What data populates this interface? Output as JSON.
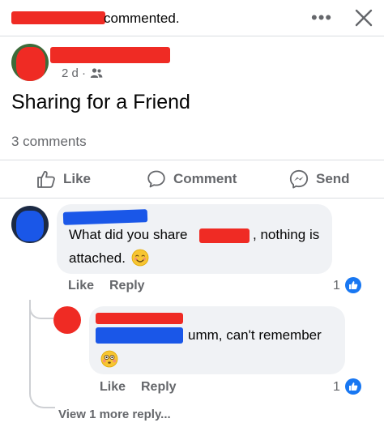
{
  "notification": {
    "suffix": "commented."
  },
  "header": {
    "more_icon": "ellipsis-icon",
    "close_icon": "close-icon"
  },
  "post": {
    "age": "2 d ·",
    "audience_icon": "friends-icon",
    "text": "Sharing for a Friend",
    "comment_count": "3 comments"
  },
  "actions": {
    "like": "Like",
    "comment": "Comment",
    "send": "Send"
  },
  "comment1": {
    "text_part1": "What did you share",
    "text_part2": ", nothing is",
    "text_line2": "attached.",
    "emoji": "smiling-face-icon",
    "like": "Like",
    "reply": "Reply",
    "reaction_count": "1"
  },
  "reply1": {
    "text": "umm, can't remember",
    "emoji": "flushed-face-icon",
    "like": "Like",
    "reply": "Reply",
    "reaction_count": "1"
  },
  "view_more": "View 1 more reply...",
  "colors": {
    "redaction_red": "#ef2b24",
    "redaction_blue": "#1a57e8",
    "facebook_blue": "#1877f2",
    "secondary_text": "#65676b",
    "bubble": "#f0f2f5"
  }
}
